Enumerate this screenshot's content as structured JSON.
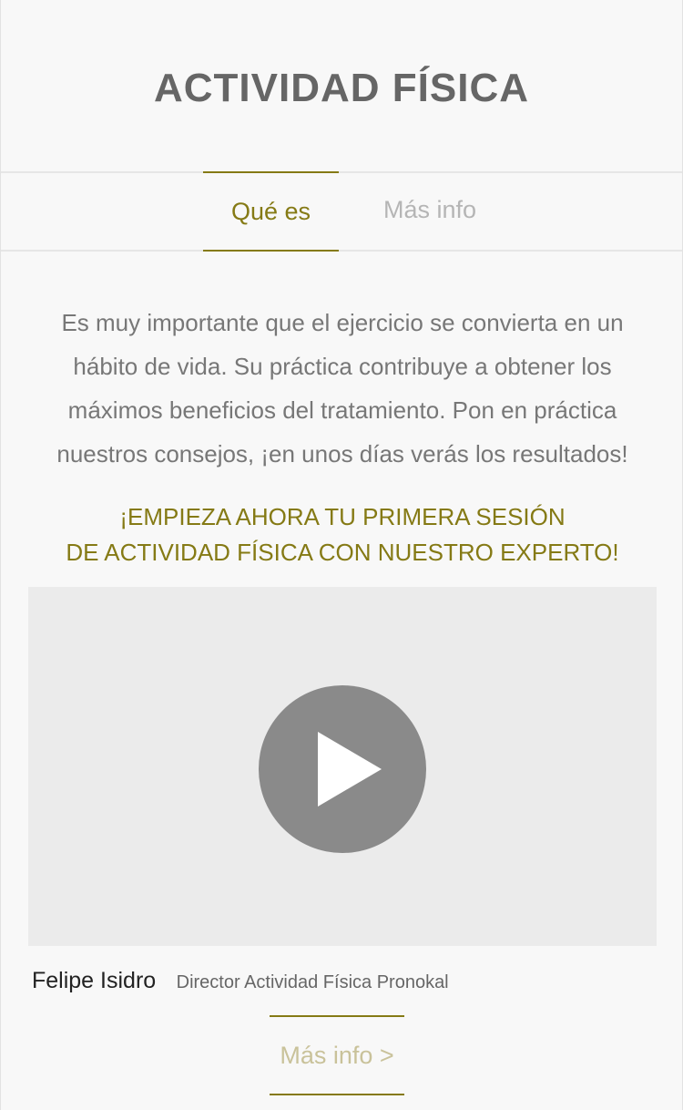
{
  "header": {
    "title": "ACTIVIDAD FÍSICA"
  },
  "tabs": [
    {
      "label": "Qué es",
      "active": true
    },
    {
      "label": "Más info",
      "active": false
    }
  ],
  "content": {
    "intro": "Es muy importante que el ejercicio se convierta en un hábito de vida. Su práctica contribuye a obtener los máximos beneficios del tratamiento. Pon en práctica nuestros consejos, ¡en unos días verás los resultados!",
    "cta_line1": "¡EMPIEZA AHORA TU PRIMERA SESIÓN",
    "cta_line2": "DE ACTIVIDAD FÍSICA CON NUESTRO EXPERTO!"
  },
  "video": {
    "play_icon": "play-icon"
  },
  "expert": {
    "name": "Felipe Isidro",
    "role": "Director Actividad Física Pronokal"
  },
  "more_link": {
    "label": "Más info >"
  },
  "colors": {
    "accent": "#857a15",
    "accent_light": "#c9c29a",
    "title": "#666666",
    "text": "#777777",
    "inactive_tab": "#b5b5b5",
    "video_bg": "#ebebeb",
    "play_button": "#8a8a8a"
  }
}
